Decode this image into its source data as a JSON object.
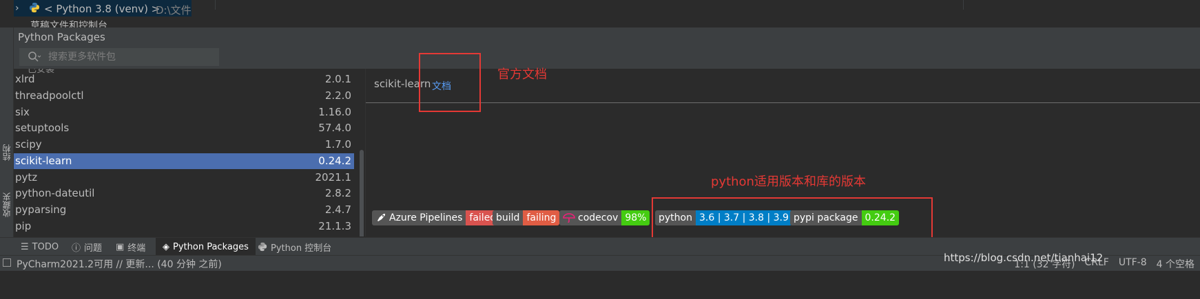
{
  "project_tree": {
    "interpreter": "< Python 3.8 (venv) >",
    "interpreter_path": "D:\\文件",
    "scratches": "草稿文件和控制台"
  },
  "left_strip": {
    "structure": "结构",
    "favorites": "收藏夹"
  },
  "panel": {
    "title": "Python Packages",
    "search_placeholder": "搜索更多软件包",
    "cutoff_label": "已安装"
  },
  "packages": [
    {
      "name": "xlrd",
      "version": "2.0.1"
    },
    {
      "name": "threadpoolctl",
      "version": "2.2.0"
    },
    {
      "name": "six",
      "version": "1.16.0"
    },
    {
      "name": "setuptools",
      "version": "57.4.0"
    },
    {
      "name": "scipy",
      "version": "1.7.0"
    },
    {
      "name": "scikit-learn",
      "version": "0.24.2",
      "selected": true
    },
    {
      "name": "pytz",
      "version": "2021.1"
    },
    {
      "name": "python-dateutil",
      "version": "2.8.2"
    },
    {
      "name": "pyparsing",
      "version": "2.4.7"
    },
    {
      "name": "pip",
      "version": "21.1.3"
    }
  ],
  "detail": {
    "package_name": "scikit-learn",
    "docs_link": "文档",
    "badges": {
      "azure": {
        "label": "Azure Pipelines",
        "status": "failed"
      },
      "build": {
        "label": "build",
        "status": "failing"
      },
      "codecov": {
        "label": "codecov",
        "value": "98%"
      },
      "python": {
        "label": "python",
        "value": "3.6 | 3.7 | 3.8 | 3.9"
      },
      "pypi": {
        "label": "pypi package",
        "value": "0.24.2"
      }
    }
  },
  "annotations": {
    "docs": "官方文档",
    "versions": "python适用版本和库的版本"
  },
  "tool_tabs": [
    {
      "label": "TODO",
      "icon": "list-icon"
    },
    {
      "label": "问题",
      "icon": "problems-icon"
    },
    {
      "label": "终端",
      "icon": "terminal-icon"
    },
    {
      "label": "Python Packages",
      "icon": "packages-icon",
      "active": true
    },
    {
      "label": "Python 控制台",
      "icon": "python-icon"
    }
  ],
  "status": {
    "message": "PyCharm2021.2可用 // 更新... (40 分钟 之前)",
    "position": "1:1 (32 字符)",
    "line_sep": "CRLF",
    "encoding": "UTF-8",
    "indent": "4 个空格"
  },
  "watermark": "https://blog.csdn.net/tianhai12",
  "colors": {
    "accent_selection": "#4b6eaf",
    "annotation_red": "#e53935",
    "link_blue": "#589df6"
  }
}
